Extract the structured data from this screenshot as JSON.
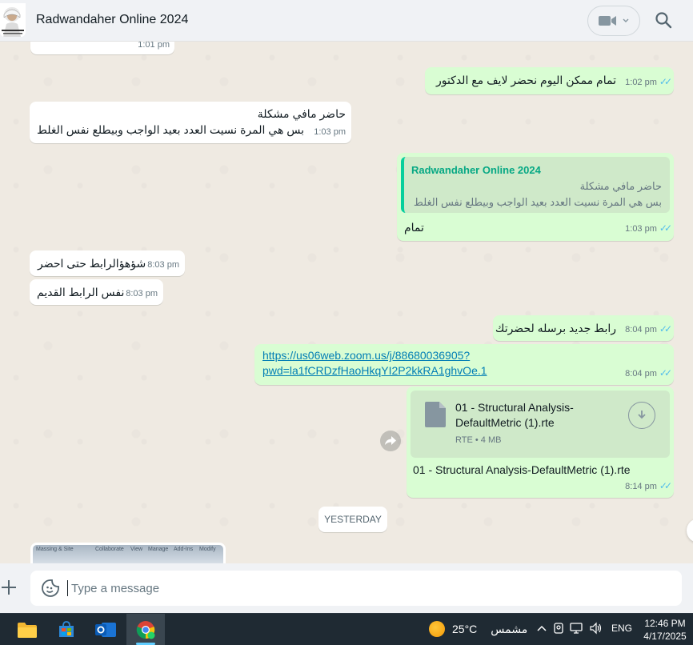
{
  "header": {
    "title": "Radwandaher Online 2024"
  },
  "messages": {
    "top_partial_time": "1:01 pm",
    "m1": {
      "text": "تمام ممكن اليوم نحضر لايف  مع الدكتور",
      "time": "1:02 pm"
    },
    "m2": {
      "line1": "حاضر مافي مشكلة",
      "line2": "بس هي المرة نسيت العدد بعيد الواجب وبيطلع نفس الغلط",
      "time": "1:03 pm"
    },
    "m3": {
      "quote_name": "Radwandaher Online 2024",
      "quote_line1": "حاضر مافي مشكلة",
      "quote_line2": "بس هي المرة نسيت العدد بعيد الواجب وبيطلع نفس الغلط",
      "text": "تمام",
      "time": "1:03 pm"
    },
    "m4": {
      "text": "شؤهؤالرابط حتى احضر",
      "time": "8:03 pm"
    },
    "m5": {
      "text": "نفس الرابط القديم",
      "time": "8:03 pm"
    },
    "m6": {
      "text": "رابط جديد برسله لحضرتك",
      "time": "8:04 pm"
    },
    "m7": {
      "line1": "https://us06web.zoom.us/j/88680036905?",
      "line2": "pwd=la1fCRDzfHaoHkqYI2P2kkRA1ghvOe.1",
      "time": "8:04 pm"
    },
    "m8": {
      "file_name": "01 - Structural Analysis-DefaultMetric (1).rte",
      "file_meta": "RTE • 4 MB",
      "caption": "01 - Structural Analysis-DefaultMetric  (1).rte",
      "time": "8:14 pm"
    },
    "date_divider": "YESTERDAY",
    "image_preview_labels": [
      "Massing & Site",
      "Collaborate",
      "View",
      "Manage",
      "Add-Ins",
      "Modify"
    ]
  },
  "composer": {
    "placeholder": "Type a message"
  },
  "taskbar": {
    "weather_temp": "25°C",
    "weather_desc": "مشمس",
    "language": "ENG",
    "time": "12:46 PM",
    "date": "4/17/2025"
  },
  "colors": {
    "incoming_bubble": "#ffffff",
    "outgoing_bubble": "#d9fdd3",
    "read_ticks": "#53bdeb",
    "quote_accent": "#06cf9c",
    "link": "#027eb5"
  }
}
